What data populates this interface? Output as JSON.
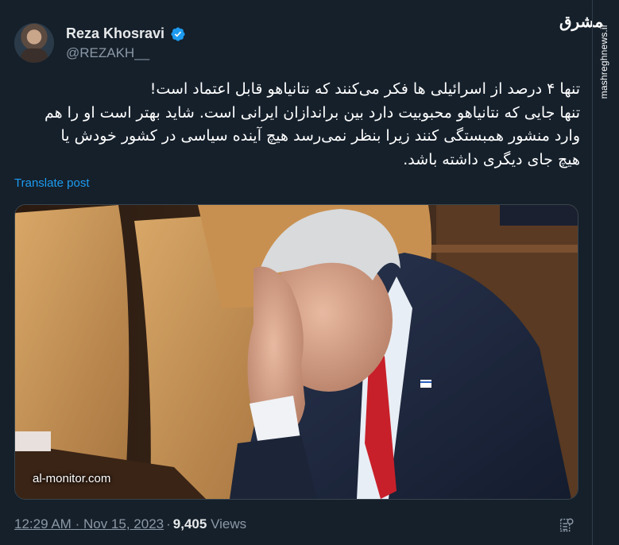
{
  "author": {
    "name": "Reza Khosravi",
    "handle": "@REZAKH__"
  },
  "icons": {
    "verified": "verified-badge-icon",
    "analytics": "analytics-icon",
    "avatar": "avatar"
  },
  "colors": {
    "accent": "#1d9bf0",
    "background": "#15202b",
    "secondary_text": "#8b98a5"
  },
  "tweet": {
    "lines": [
      "تنها ۴ درصد از اسرائیلی ها فکر می‌کنند که نتانیاهو قابل اعتماد است!",
      "تنها جایی که نتانیاهو محبوبیت دارد بین براندازان ایرانی است. شاید بهتر است او را هم",
      "وارد منشور همبستگی کنند زیرا بنظر نمی‌رسد هیچ آینده سیاسی در کشور خودش یا",
      "هیچ جای دیگری داشته باشد."
    ],
    "translate_label": "Translate post"
  },
  "media": {
    "credit": "al-monitor.com"
  },
  "meta": {
    "time": "12:29 AM",
    "separator": "·",
    "date": "Nov 15, 2023",
    "views_count": "9,405",
    "views_label": "Views"
  },
  "watermark": {
    "site": "mashreghnews.ir",
    "logo_text": "مشرق"
  }
}
